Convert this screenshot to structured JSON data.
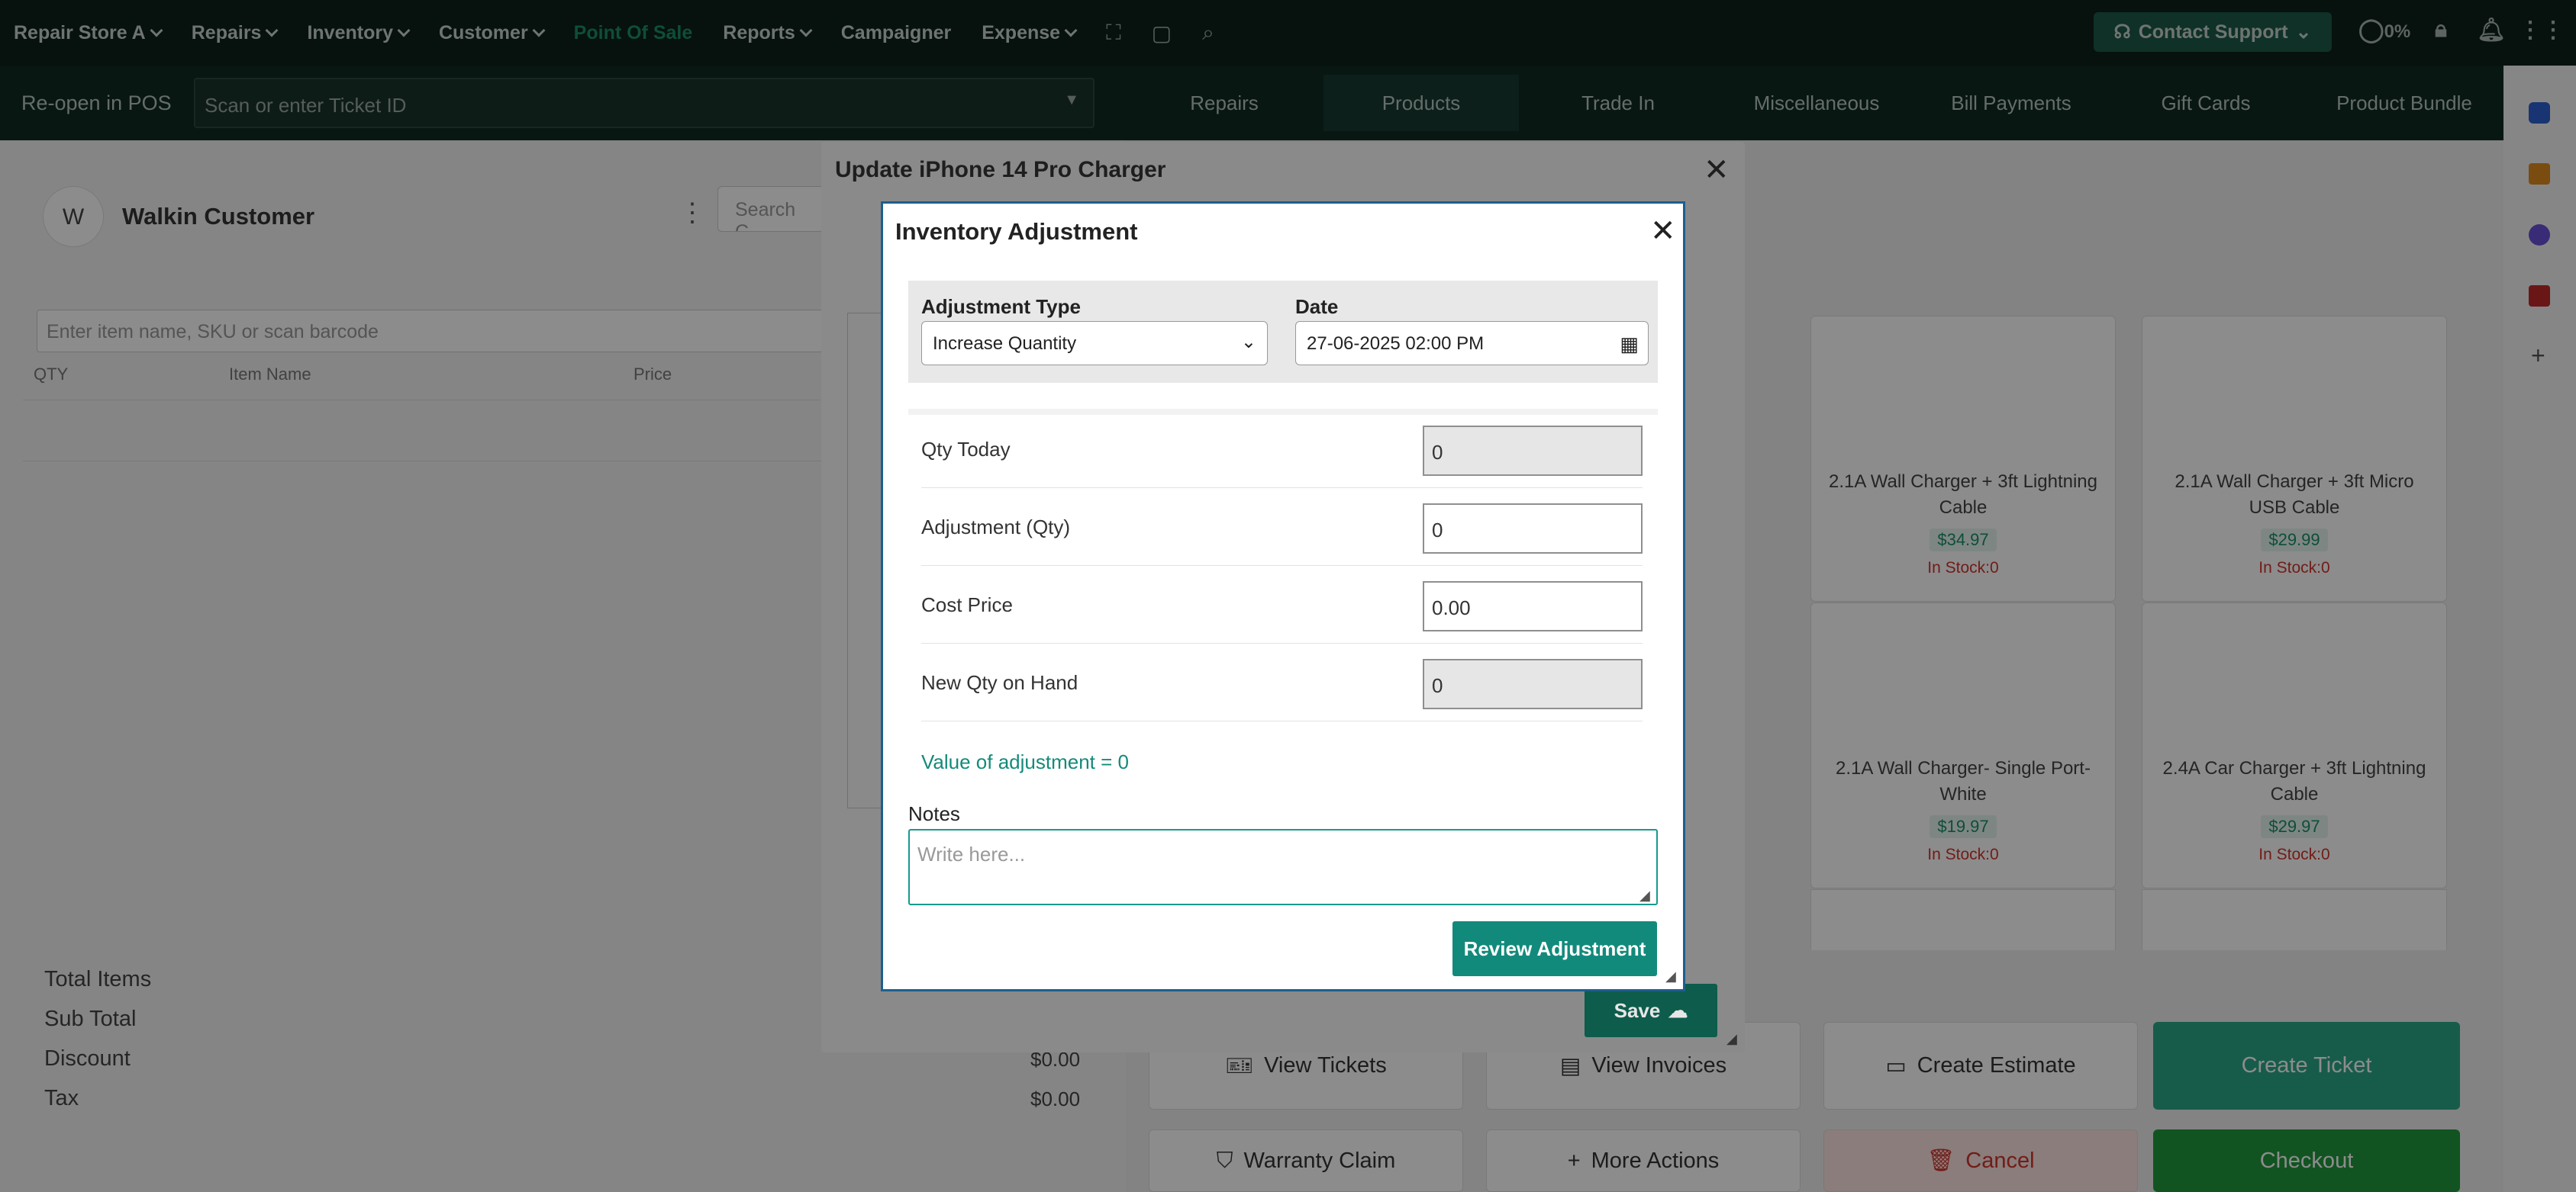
{
  "topnav": {
    "items": [
      {
        "label": "Repair Store A",
        "chevron": true
      },
      {
        "label": "Repairs",
        "chevron": true
      },
      {
        "label": "Inventory",
        "chevron": true
      },
      {
        "label": "Customer",
        "chevron": true
      },
      {
        "label": "Point Of Sale",
        "chevron": false,
        "active": true
      },
      {
        "label": "Reports",
        "chevron": true
      },
      {
        "label": "Campaigner",
        "chevron": false
      },
      {
        "label": "Expense",
        "chevron": true
      }
    ],
    "contact_support": "Contact Support",
    "progress": "0%"
  },
  "secbar": {
    "reopen_label": "Re-open in POS",
    "ticket_placeholder": "Scan or enter Ticket ID",
    "tabs": [
      "Repairs",
      "Products",
      "Trade In",
      "Miscellaneous",
      "Bill Payments",
      "Gift Cards",
      "Product Bundle"
    ]
  },
  "left": {
    "avatar_initial": "W",
    "customer_name": "Walkin Customer",
    "search_partial": "Search C",
    "item_placeholder": "Enter item name, SKU or scan barcode",
    "columns": [
      "QTY",
      "Item Name",
      "Price"
    ],
    "totals": [
      {
        "label": "Total Items",
        "value": ""
      },
      {
        "label": "Sub Total",
        "value": ""
      },
      {
        "label": "Discount",
        "value": "$0.00"
      },
      {
        "label": "Tax",
        "value": "$0.00"
      }
    ]
  },
  "products": [
    {
      "name": "2.1A Wall Charger + 3ft Lightning Cable",
      "price": "$34.97",
      "stock": "In Stock:0"
    },
    {
      "name": "2.1A Wall Charger + 3ft Micro USB Cable",
      "price": "$29.99",
      "stock": "In Stock:0"
    },
    {
      "name": "2.1A Wall Charger- Single Port-White",
      "price": "$19.97",
      "stock": "In Stock:0"
    },
    {
      "name": "2.4A Car Charger + 3ft Lightning Cable",
      "price": "$29.97",
      "stock": "In Stock:0"
    }
  ],
  "actions": {
    "view_tickets": "View Tickets",
    "view_invoices": "View Invoices",
    "create_estimate": "Create Estimate",
    "create_ticket": "Create Ticket",
    "warranty_claim": "Warranty Claim",
    "more_actions": "More Actions",
    "cancel": "Cancel",
    "checkout": "Checkout"
  },
  "update_modal": {
    "title": "Update iPhone 14 Pro Charger",
    "save_label": "Save"
  },
  "inventory_modal": {
    "title": "Inventory Adjustment",
    "adjustment_type_label": "Adjustment Type",
    "adjustment_type_value": "Increase Quantity",
    "date_label": "Date",
    "date_value": "27-06-2025 02:00 PM",
    "fields": [
      {
        "label": "Qty Today",
        "value": "0",
        "readonly": true
      },
      {
        "label": "Adjustment (Qty)",
        "value": "0",
        "readonly": false
      },
      {
        "label": "Cost Price",
        "value": "0.00",
        "readonly": false
      },
      {
        "label": "New Qty on Hand",
        "value": "0",
        "readonly": true
      }
    ],
    "value_of_adjustment": "Value of adjustment = 0",
    "notes_label": "Notes",
    "notes_placeholder": "Write here...",
    "review_button": "Review Adjustment"
  },
  "colors": {
    "nav_bg": "#0d1f1a",
    "accent": "#128a7b",
    "modal_border": "#1d5f8f"
  }
}
